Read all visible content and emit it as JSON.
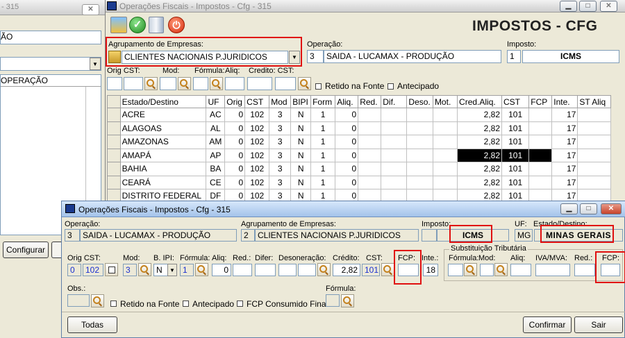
{
  "back_window": {
    "title": "- 315",
    "field1_value": "ÃO",
    "col_header": "OPERAÇÃO",
    "configure_button": "Configurar"
  },
  "main_window": {
    "title": "Operações Fiscais - Impostos - Cfg - 315",
    "heading": "IMPOSTOS - CFG",
    "group_label": "Agrupamento de Empresas:",
    "group_value": "CLIENTES NACIONAIS P.JURIDICOS",
    "operation_label": "Operação:",
    "operation_code": "3",
    "operation_value": "SAIDA - LUCAMAX - PRODUÇÃO",
    "tax_label": "Imposto:",
    "tax_code": "1",
    "tax_value": "ICMS",
    "filters": {
      "orig_cst": "Orig CST:",
      "mod": "Mod:",
      "formula": "Fórmula:",
      "aliq": "Aliq:",
      "credito_cst": "Credito: CST:",
      "retido": "Retido na Fonte",
      "antecipado": "Antecipado"
    },
    "table": {
      "headers": [
        "Estado/Destino",
        "UF",
        "Orig",
        "CST",
        "Mod",
        "BIPI",
        "Form",
        "Aliq.",
        "Red.",
        "Dif.",
        "Deso.",
        "Mot.",
        "Cred.Aliq.",
        "CST",
        "FCP",
        "Inte.",
        "ST Aliq"
      ],
      "rows": [
        [
          "ACRE",
          "AC",
          "0",
          "102",
          "3",
          "N",
          "1",
          "0",
          "",
          "",
          "",
          "",
          "2,82",
          "101",
          "",
          "17",
          ""
        ],
        [
          "ALAGOAS",
          "AL",
          "0",
          "102",
          "3",
          "N",
          "1",
          "0",
          "",
          "",
          "",
          "",
          "2,82",
          "101",
          "",
          "17",
          ""
        ],
        [
          "AMAZONAS",
          "AM",
          "0",
          "102",
          "3",
          "N",
          "1",
          "0",
          "",
          "",
          "",
          "",
          "2,82",
          "101",
          "",
          "17",
          ""
        ],
        [
          "AMAPÁ",
          "AP",
          "0",
          "102",
          "3",
          "N",
          "1",
          "0",
          "",
          "",
          "",
          "",
          "2,82",
          "101",
          "",
          "17",
          ""
        ],
        [
          "BAHIA",
          "BA",
          "0",
          "102",
          "3",
          "N",
          "1",
          "0",
          "",
          "",
          "",
          "",
          "2,82",
          "101",
          "",
          "17",
          ""
        ],
        [
          "CEARÁ",
          "CE",
          "0",
          "102",
          "3",
          "N",
          "1",
          "0",
          "",
          "",
          "",
          "",
          "2,82",
          "101",
          "",
          "17",
          ""
        ],
        [
          "DISTRITO FEDERAL",
          "DF",
          "0",
          "102",
          "3",
          "N",
          "1",
          "0",
          "",
          "",
          "",
          "",
          "2,82",
          "101",
          "",
          "17",
          ""
        ]
      ]
    }
  },
  "dialog": {
    "title": "Operações Fiscais - Impostos - Cfg - 315",
    "operation_label": "Operação:",
    "operation_code": "3",
    "operation_value": "SAIDA - LUCAMAX - PRODUÇÃO",
    "group_label": "Agrupamento de Empresas:",
    "group_code": "2",
    "group_value": "CLIENTES NACIONAIS P.JURIDICOS",
    "tax_label": "Imposto:",
    "tax_value": "ICMS",
    "uf_label": "UF:",
    "uf_value": "MG",
    "state_label": "Estado/Destino:",
    "state_value": "MINAS GERAIS",
    "orig_cst_label": "Orig CST:",
    "orig_value": "0",
    "cst_value": "102",
    "mod_label": "Mod:",
    "mod_value": "3",
    "bipi_label": "B. IPI:",
    "bipi_value": "N",
    "formula_label": "Fórmula:",
    "formula_value": "1",
    "aliq_label": "Aliq:",
    "aliq_value": "0",
    "red_label": "Red.:",
    "difer_label": "Difer:",
    "deson_label": "Desoneração:",
    "credito_label": "Crédito:",
    "credito_value": "2,82",
    "cst2_label": "CST:",
    "cst2_value": "101",
    "fcp_label": "FCP:",
    "inte_label": "Inte.:",
    "inte_value": "18",
    "st_group_label": "Substituição Tributária",
    "st_formula_label": "Fórmula:",
    "st_mod_label": "Mod:",
    "st_aliq_label": "Aliq:",
    "st_iva_label": "IVA/MVA:",
    "st_red_label": "Red.:",
    "st_fcp_label": "FCP:",
    "obs_label": "Obs.:",
    "retido_label": "Retido na Fonte",
    "antecipado_label": "Antecipado",
    "fcp_consumido_label": "FCP Consumido Final",
    "formula2_label": "Fórmula:",
    "todas_button": "Todas",
    "confirmar_button": "Confirmar",
    "sair_button": "Sair"
  }
}
